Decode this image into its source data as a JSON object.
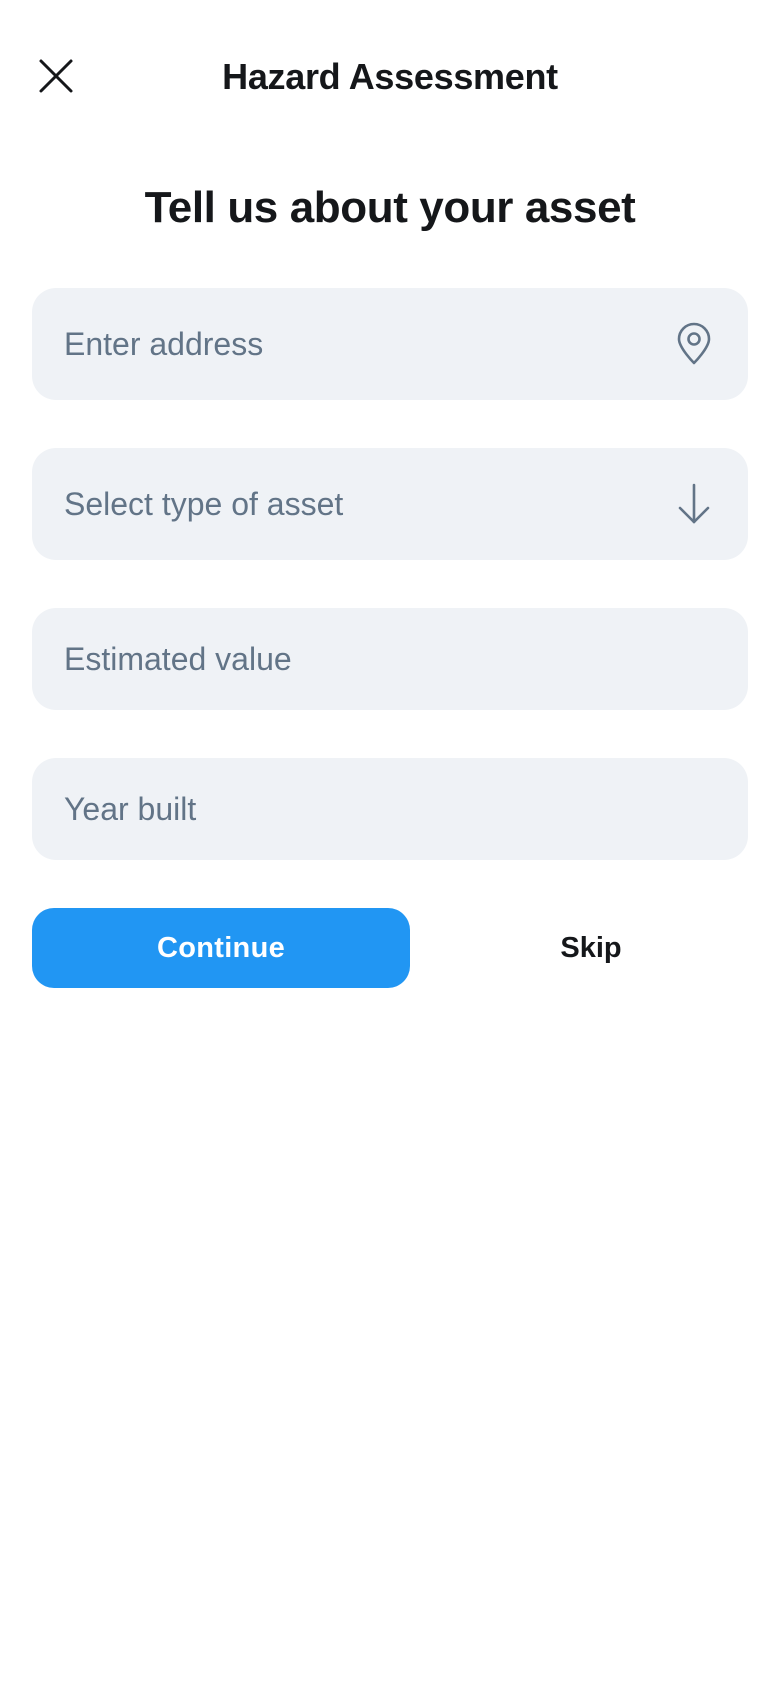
{
  "header": {
    "title": "Hazard Assessment",
    "close_icon": "close-icon"
  },
  "main": {
    "heading": "Tell us about your asset"
  },
  "form": {
    "address": {
      "placeholder": "Enter address",
      "value": "",
      "icon": "map-pin-icon"
    },
    "asset_type": {
      "placeholder": "Select type of asset",
      "selected": "",
      "icon": "arrow-down-icon"
    },
    "estimated_value": {
      "placeholder": "Estimated value",
      "value": ""
    },
    "year_built": {
      "placeholder": "Year built",
      "value": ""
    }
  },
  "actions": {
    "continue_label": "Continue",
    "skip_label": "Skip"
  },
  "colors": {
    "accent": "#2196f3",
    "field_bg": "#eff2f6",
    "placeholder": "#627487",
    "text": "#15171a"
  }
}
